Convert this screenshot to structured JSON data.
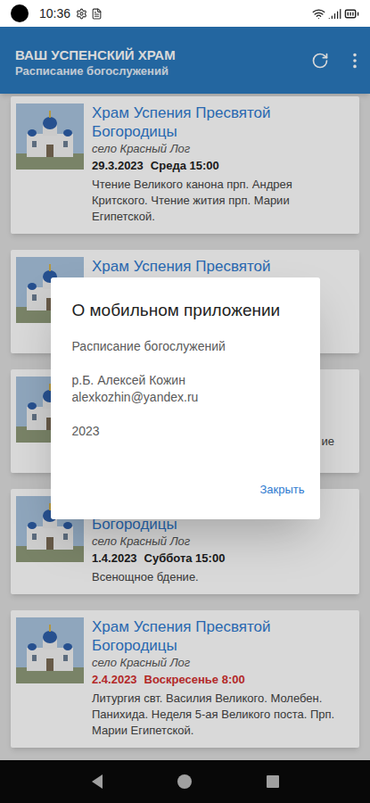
{
  "status_bar": {
    "time": "10:36"
  },
  "app_bar": {
    "title": "ВАШ УСПЕНСКИЙ ХРАМ",
    "subtitle": "Расписание богослужений"
  },
  "services": [
    {
      "kind": "full",
      "title": "Храм Успения Пресвятой Богородицы",
      "place": "село Красный Лог",
      "date": "29.3.2023",
      "weekday_time": "Среда 15:00",
      "description": "Чтение Великого канона прп. Андрея Критского. Чтение жития прп. Марии Египетской.",
      "highlighted": false
    },
    {
      "kind": "partial",
      "title": "Храм Успения Пресвятой",
      "fragment": ""
    },
    {
      "kind": "partial",
      "title": "",
      "fragment": "ие"
    },
    {
      "kind": "full",
      "title": "Храм Успения Пресвятой Богородицы",
      "place": "село Красный Лог",
      "date": "1.4.2023",
      "weekday_time": "Суббота 15:00",
      "description": "Всенощное бдение.",
      "highlighted": false
    },
    {
      "kind": "full",
      "title": "Храм Успения Пресвятой Богородицы",
      "place": "село Красный Лог",
      "date": "2.4.2023",
      "weekday_time": "Воскресенье 8:00",
      "description": "Литургия свт. Василия Великого. Молебен. Панихида. Неделя 5-ая Великого поста. Прп. Марии Египетской.",
      "highlighted": true
    }
  ],
  "dialog": {
    "title": "О мобильном приложении",
    "paragraphs": [
      [
        "Расписание богослужений"
      ],
      [
        "р.Б. Алексей Кожин",
        "alexkozhin@yandex.ru"
      ],
      [
        "2023"
      ]
    ],
    "button": "Закрыть"
  }
}
